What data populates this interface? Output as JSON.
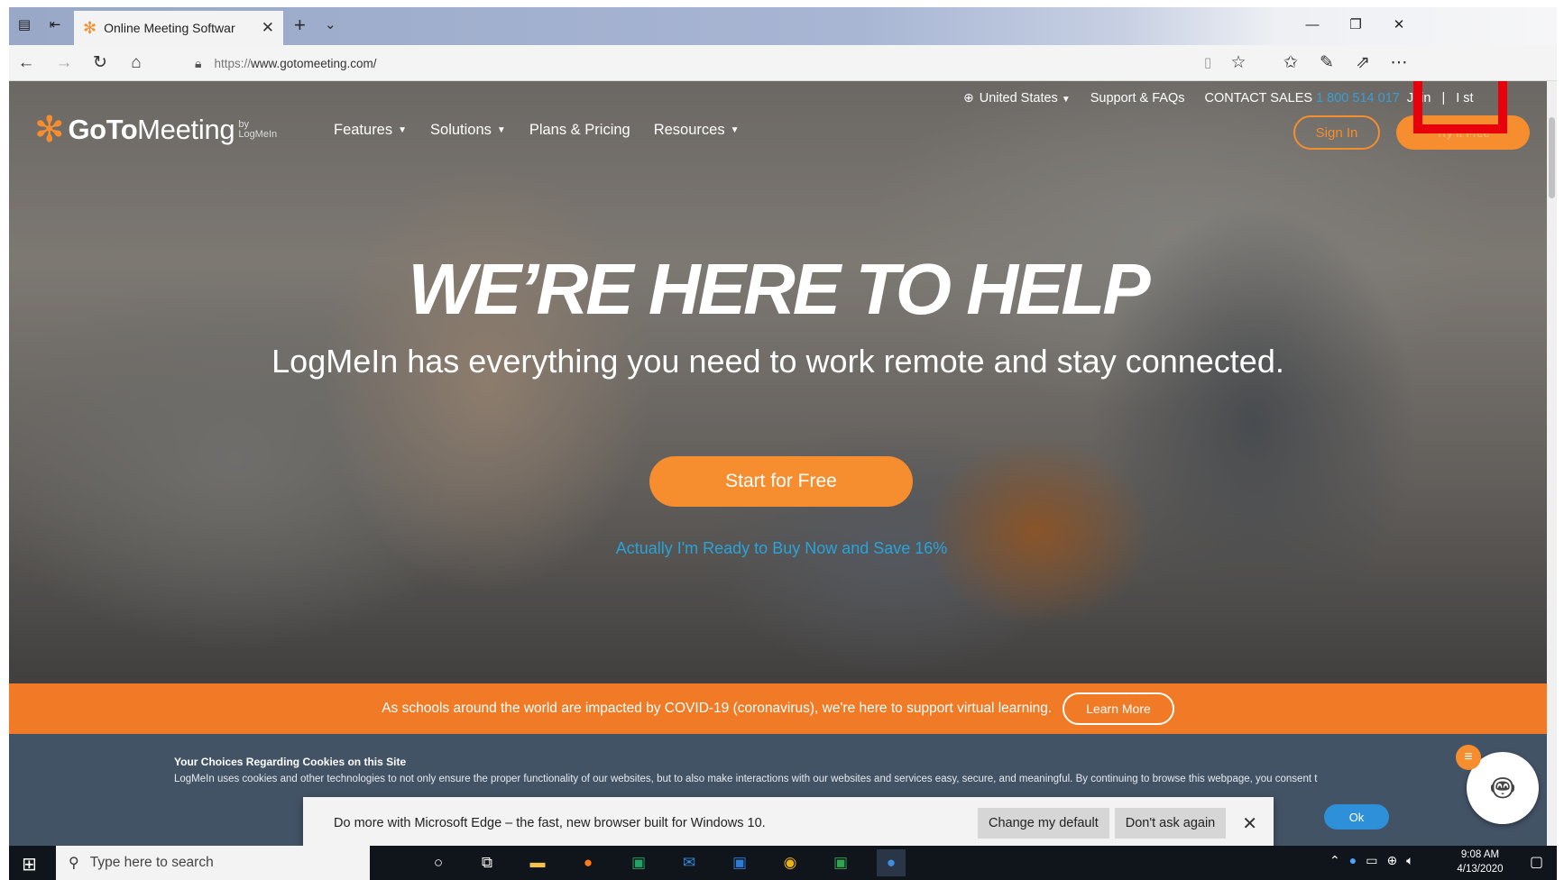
{
  "browser": {
    "tab_title": "Online Meeting Softwar",
    "url_protocol": "https://",
    "url_host": "www.gotomeeting.com/"
  },
  "site": {
    "logo_goto": "GoTo",
    "logo_meeting": "Meeting",
    "logo_by": "by LogMeIn",
    "nav": [
      "Features",
      "Solutions",
      "Plans & Pricing",
      "Resources"
    ],
    "utility": {
      "country": "United States",
      "support": "Support & FAQs",
      "contact_label": "CONTACT SALES",
      "contact_phone": "1 800 514",
      "phone_tail": "017",
      "join": "Join",
      "separator": "|",
      "host": "I  st"
    },
    "signin": "Sign In",
    "try_free": "Try It Free"
  },
  "hero": {
    "headline": "WE’RE HERE TO HELP",
    "subhead": "LogMeIn has everything you need to work remote and stay connected.",
    "cta": "Start for Free",
    "buy_link": "Actually I'm Ready to Buy Now and Save 16%"
  },
  "covid": {
    "message": "As schools around the world are impacted by COVID-19 (coronavirus), we're here to support virtual learning.",
    "learn_more": "Learn More"
  },
  "cookie": {
    "title": "Your Choices Regarding Cookies on this Site",
    "body": "LogMeIn uses cookies and other technologies to not only ensure the proper functionality of our websites, but to also make interactions with our websites and services easy, secure, and meaningful. By continuing to browse this webpage, you consent t",
    "ok": "Ok"
  },
  "edge_banner": {
    "message": "Do more with Microsoft Edge – the fast, new browser built for Windows 10.",
    "change_default": "Change my default",
    "dont_ask": "Don't ask again"
  },
  "taskbar": {
    "search_placeholder": "Type here to search",
    "time": "9:08 AM",
    "date": "4/13/2020"
  },
  "colors": {
    "brand_orange": "#f68d2e",
    "covid_orange": "#f07a25",
    "link_blue": "#2aa3d8",
    "highlight_red": "#e8000b"
  }
}
